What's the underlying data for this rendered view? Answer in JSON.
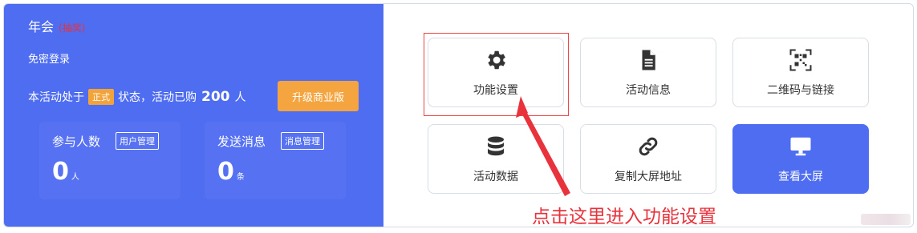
{
  "event": {
    "title": "年会",
    "tag": "(抽奖)",
    "login_mode": "免密登录"
  },
  "status": {
    "prefix": "本活动处于",
    "badge": "正式",
    "middle": "状态，活动已购",
    "count": "200",
    "suffix": "人",
    "upgrade_label": "升级商业版"
  },
  "stats": [
    {
      "label": "参与人数",
      "button": "用户管理",
      "value": "0",
      "unit": "人"
    },
    {
      "label": "发送消息",
      "button": "消息管理",
      "value": "0",
      "unit": "条"
    }
  ],
  "features": [
    {
      "label": "功能设置",
      "icon": "gear-icon"
    },
    {
      "label": "活动信息",
      "icon": "document-icon"
    },
    {
      "label": "二维码与链接",
      "icon": "qrcode-icon"
    },
    {
      "label": "活动数据",
      "icon": "database-icon"
    },
    {
      "label": "复制大屏地址",
      "icon": "link-icon"
    },
    {
      "label": "查看大屏",
      "icon": "monitor-icon"
    }
  ],
  "annotation": {
    "text": "点击这里进入功能设置",
    "color": "#e8323c"
  },
  "colors": {
    "primary": "#4f6df0",
    "accent": "#f4a53f"
  }
}
